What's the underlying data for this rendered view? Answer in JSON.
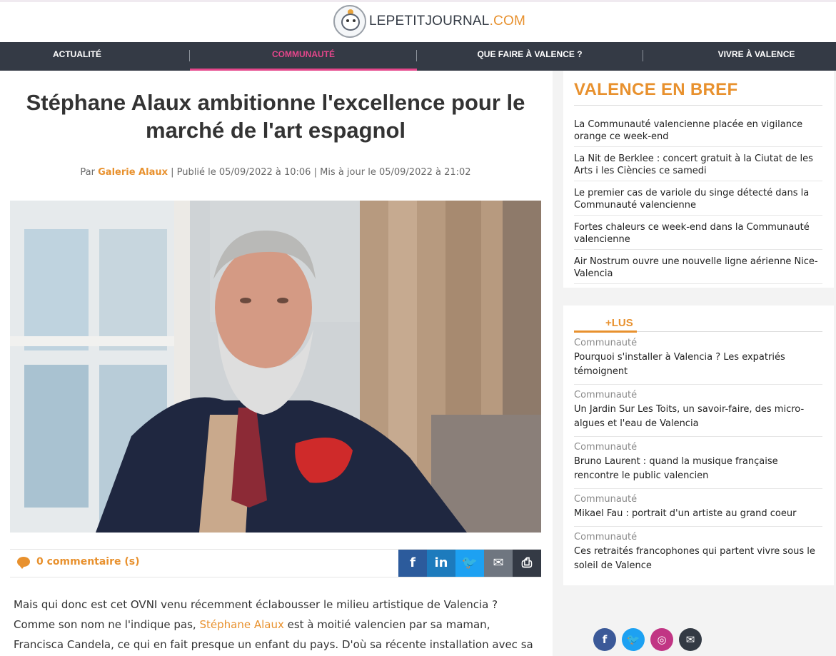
{
  "site": {
    "logo_main": "LEPETITJOURNAL",
    "logo_suffix": ".COM"
  },
  "nav": [
    {
      "label": "ACTUALITÉ"
    },
    {
      "label": "COMMUNAUTÉ"
    },
    {
      "label": "QUE FAIRE À VALENCE ?"
    },
    {
      "label": "VIVRE À VALENCE"
    }
  ],
  "article": {
    "title": "Stéphane Alaux ambitionne l'excellence pour le marché de l'art espagnol",
    "by_prefix": "Par",
    "author": "Galerie Alaux",
    "published": "| Publié le 05/09/2022 à 10:06 | Mis à jour le 05/09/2022 à 21:02",
    "comments": "0 commentaire (s)",
    "body_before": "Mais qui donc est cet OVNI venu récemment éclabousser le milieu artistique de Valencia ? Comme son nom ne l'indique pas,",
    "body_link": "Stéphane Alaux",
    "body_after": "est à moitié valencien par sa maman, Francisca Candela, ce qui en fait presque un enfant du pays. D'où sa récente installation avec sa famille dans la capitale de la"
  },
  "share": [
    {
      "icon": "facebook-icon",
      "glyph": "f",
      "color": "#2c5b9c"
    },
    {
      "icon": "linkedin-icon",
      "glyph": "in",
      "color": "#1d7bbd"
    },
    {
      "icon": "twitter-icon",
      "glyph": "🐦",
      "color": "#1da1f2"
    },
    {
      "icon": "mail-icon",
      "glyph": "✉",
      "color": "#6f7680"
    },
    {
      "icon": "print-icon",
      "glyph": "⎙",
      "color": "#343a45"
    }
  ],
  "brief": {
    "title": "VALENCE EN BREF",
    "items": [
      "La Communauté valencienne placée en vigilance orange ce week-end",
      "La Nit de Berklee : concert gratuit à la Ciutat de les Arts i les Ciències ce samedi",
      "Le premier cas de variole du singe détecté dans la Communauté valencienne",
      "Fortes chaleurs ce week-end dans la Communauté valencienne",
      "Air Nostrum ouvre une nouvelle ligne aérienne Nice-Valencia"
    ]
  },
  "most_read": {
    "title": "+LUS",
    "items": [
      {
        "category": "Communauté",
        "title": "Pourquoi s'installer à Valencia ? Les expatriés témoignent"
      },
      {
        "category": "Communauté",
        "title": "Un Jardin Sur Les Toits, un savoir-faire, des micro-algues et l'eau de Valencia"
      },
      {
        "category": "Communauté",
        "title": "Bruno Laurent : quand la musique française rencontre le public valencien"
      },
      {
        "category": "Communauté",
        "title": "Mikael Fau : portrait d'un artiste au grand coeur"
      },
      {
        "category": "Communauté",
        "title": "Ces retraités francophones qui partent vivre sous le soleil de Valence"
      }
    ]
  },
  "footer_social": [
    {
      "icon": "facebook-icon",
      "glyph": "f",
      "color": "#3b5998"
    },
    {
      "icon": "twitter-icon",
      "glyph": "🐦",
      "color": "#1da1f2"
    },
    {
      "icon": "instagram-icon",
      "glyph": "◎",
      "color": "#c13584"
    },
    {
      "icon": "mail-icon",
      "glyph": "✉",
      "color": "#333a44"
    }
  ]
}
